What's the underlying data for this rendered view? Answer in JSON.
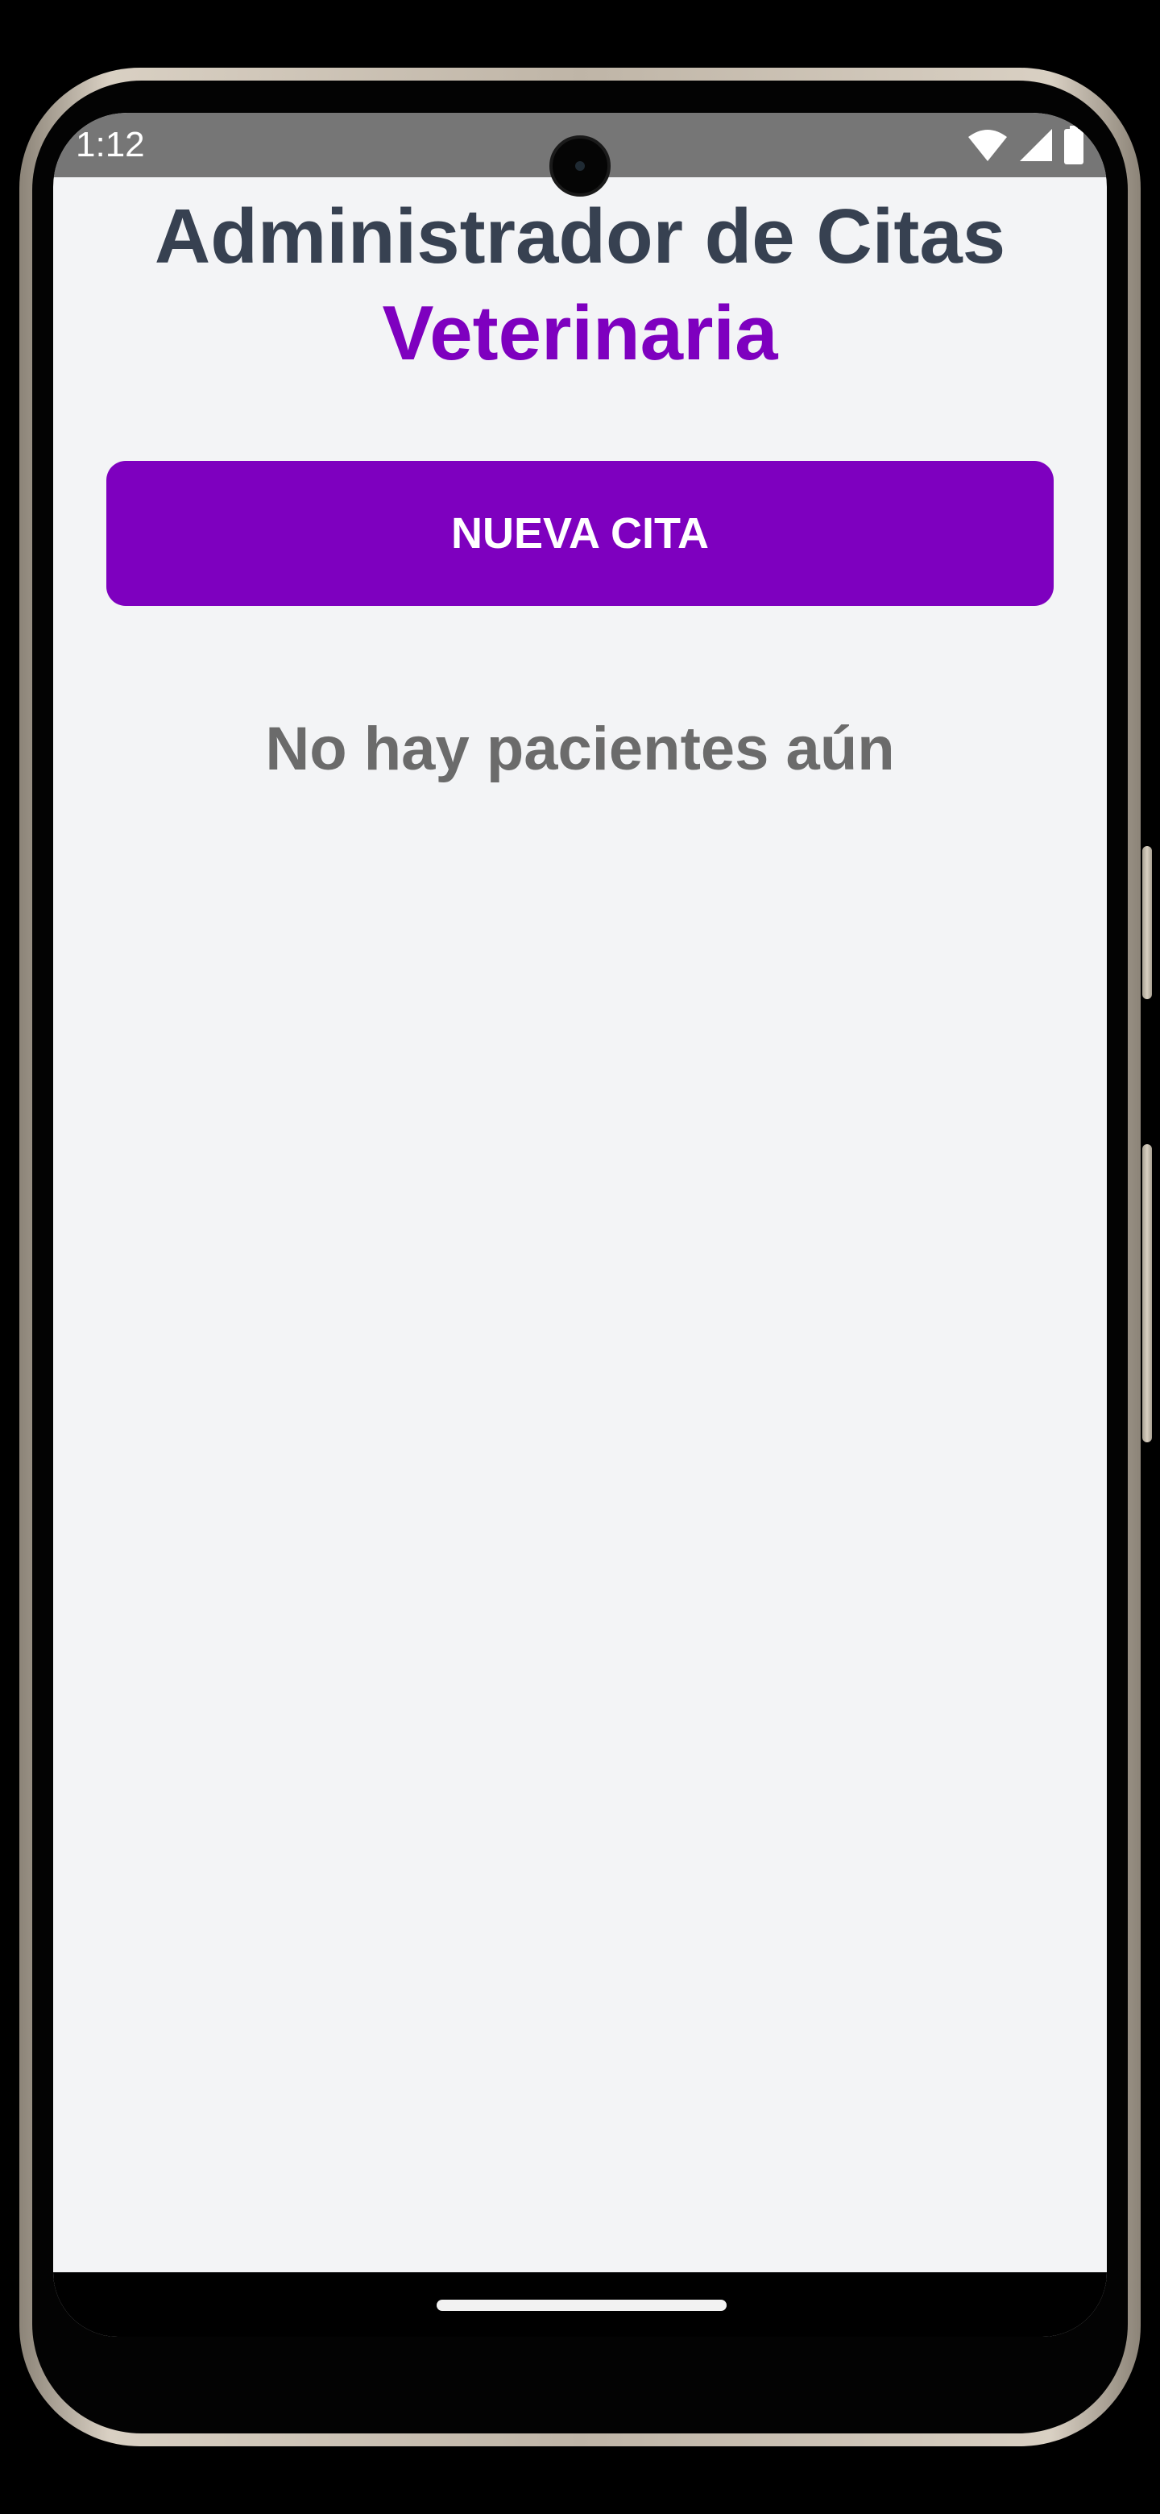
{
  "status_bar": {
    "time": "1:12",
    "icons": [
      "wifi-icon",
      "cellular-signal-icon",
      "battery-icon"
    ]
  },
  "header": {
    "title_line1": "Administrador de Citas",
    "title_line2": "Veterinaria"
  },
  "actions": {
    "new_appointment_label": "NUEVA CITA"
  },
  "patients": {
    "empty_message": "No hay pacientes aún"
  },
  "colors": {
    "accent": "#7e00bf",
    "title": "#374151",
    "muted_text": "#6b6b6b",
    "background": "#f3f4f6",
    "status_bar": "#767676"
  }
}
